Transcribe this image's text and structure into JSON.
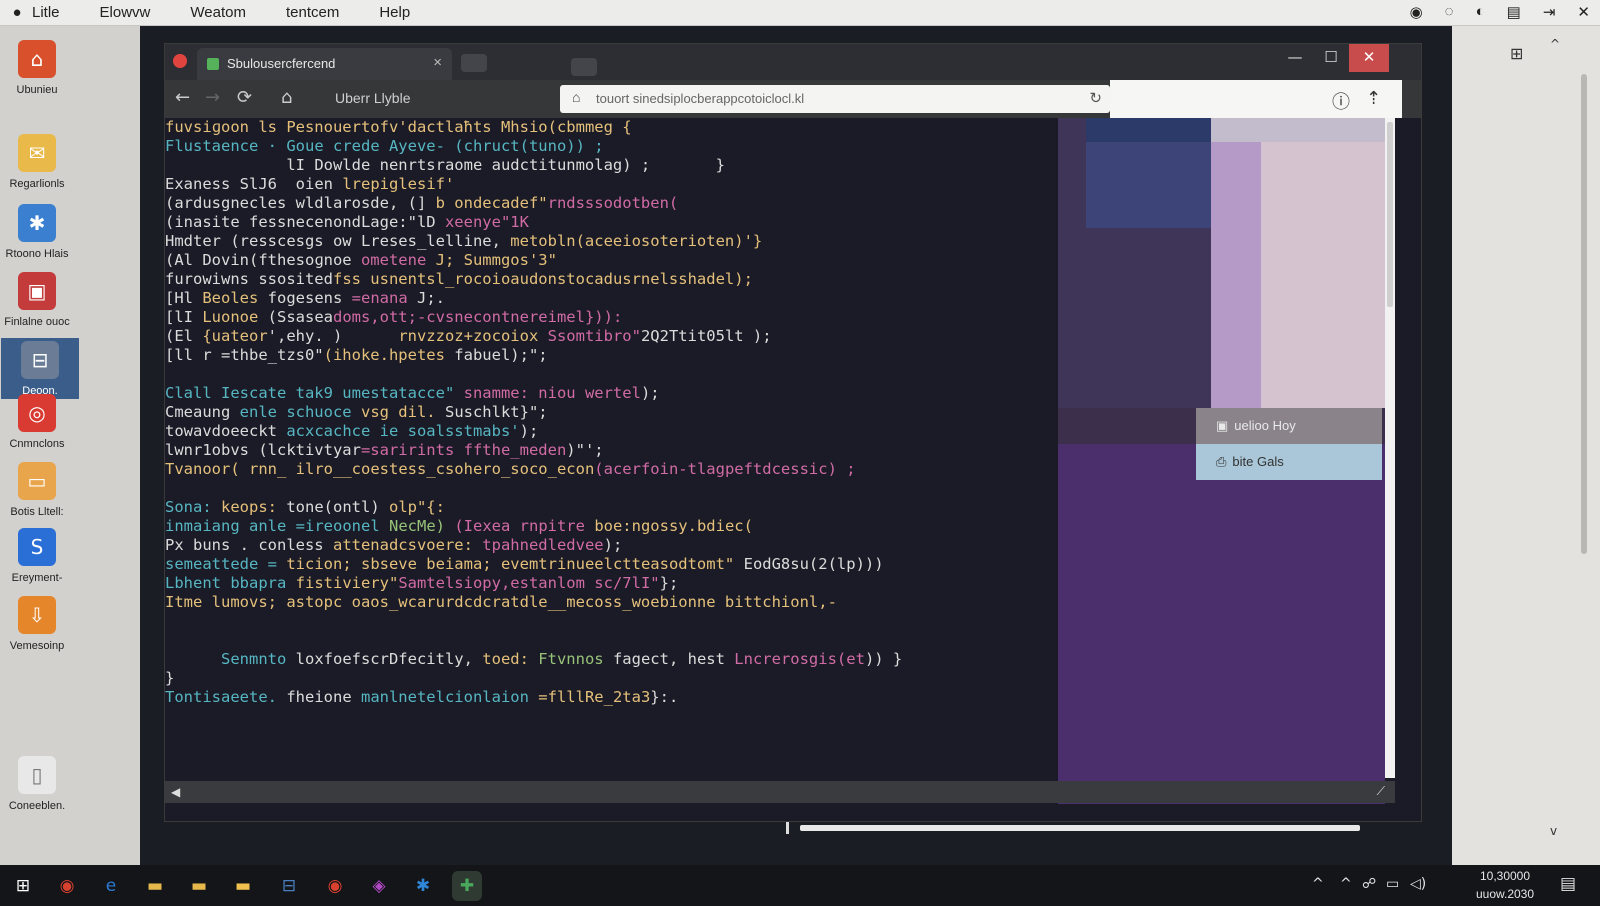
{
  "menubar": {
    "apple_icon": "apple-icon",
    "items": [
      "Litle",
      "Elowvw",
      "Weatom",
      "tentcem",
      "Help"
    ],
    "status_icons": [
      "◉",
      "◌",
      "◐",
      "▤",
      "⇥",
      "✕"
    ]
  },
  "desktop": {
    "icons": [
      {
        "label": "Ubunieu",
        "glyph": "⌂",
        "color": "#d9502c"
      },
      {
        "label": "Regarlionls",
        "glyph": "✉",
        "color": "#e9b94a"
      },
      {
        "label": "Rtoono Hlais",
        "glyph": "✱",
        "color": "#3b7fd0"
      },
      {
        "label": "Finlalne ouoc",
        "glyph": "▣",
        "color": "#c43b3b"
      },
      {
        "label": "Deoon.",
        "glyph": "⊟",
        "color": "#6b7d96"
      },
      {
        "label": "Cnmnclons",
        "glyph": "◎",
        "color": "#d93a31"
      },
      {
        "label": "Botis Lltell:",
        "glyph": "▭",
        "color": "#e8a54b"
      },
      {
        "label": "Ereyment-",
        "glyph": "S",
        "color": "#2a6fd6"
      },
      {
        "label": "Vemesoinp",
        "glyph": "⇩",
        "color": "#e6862b"
      },
      {
        "label": "Coneeblen.",
        "glyph": "▯",
        "color": "#e8e8e8"
      }
    ],
    "right_icon": "⊞",
    "right_scroll_up": "^",
    "right_scroll_down": "v"
  },
  "browser": {
    "tab_title": "Sbulousercfercend",
    "tab_close": "×",
    "win_min": "—",
    "win_max": "☐",
    "win_close": "✕",
    "back": "←",
    "forward": "→",
    "reload": "⟳",
    "home": "⌂",
    "path_label": "Uberr Llyble",
    "url": "touort sinedsiplocberappcotoiclocl.kl",
    "url_reload": "↻",
    "info_icon": "ⓘ",
    "share_icon": "⇡",
    "hscroll_left": "◀",
    "resize": "⟋"
  },
  "code_lines": [
    [
      {
        "t": "fuvsiɡoon ls Pesnouertofv'dactlaħts ",
        "c": "y"
      },
      {
        "t": "Mhsio(cbmmeg {",
        "c": "y"
      }
    ],
    [
      {
        "t": "Flustaence · ",
        "c": "c"
      },
      {
        "t": "Goue crede Ayeve- (chruct(tuno)) ;",
        "c": "c"
      }
    ],
    [
      {
        "t": "             lI ",
        "c": "w"
      },
      {
        "t": "Dowlde nenrtsraome audctitunmolag) ;       }",
        "c": "w"
      }
    ],
    [
      {
        "t": "Exaness SlJ6  ",
        "c": "w"
      },
      {
        "t": "oien ",
        "c": "w"
      },
      {
        "t": "lrepiglesif'",
        "c": "y"
      }
    ],
    [
      {
        "t": "(ardusgnecles wldlarosde, (] ",
        "c": "w"
      },
      {
        "t": "b ondecadef\"",
        "c": "y"
      },
      {
        "t": "rndsssodotben(",
        "c": "p"
      }
    ],
    [
      {
        "t": "(inasite fessnecenondLage:\"lD ",
        "c": "w"
      },
      {
        "t": "xeenye\"1K",
        "c": "p"
      }
    ],
    [
      {
        "t": "Hmdter (resscesgs ow Lreses_lelline, ",
        "c": "w"
      },
      {
        "t": "metobln(aceeiosoterioten)'}",
        "c": "y"
      }
    ],
    [
      {
        "t": "(Al Dovin(fthesoɡnoe ",
        "c": "w"
      },
      {
        "t": "ometene ",
        "c": "p"
      },
      {
        "t": "J; Summgos'3\"",
        "c": "y"
      }
    ],
    [
      {
        "t": "furowiwns ssosited",
        "c": "w"
      },
      {
        "t": "fss usnentsl_rocoioaudonstocadusrnelsshadel);",
        "c": "y"
      }
    ],
    [
      {
        "t": "[Hl ",
        "c": "w"
      },
      {
        "t": "Beoles ",
        "c": "y"
      },
      {
        "t": "fogesens ",
        "c": "w"
      },
      {
        "t": "=enana ",
        "c": "p"
      },
      {
        "t": "J;.",
        "c": "w"
      }
    ],
    [
      {
        "t": "[lI ",
        "c": "w"
      },
      {
        "t": "Luonoe ",
        "c": "y"
      },
      {
        "t": "(Ssasea",
        "c": "w"
      },
      {
        "t": "doms,ott;-cvsnecontnereimel})):",
        "c": "p"
      }
    ],
    [
      {
        "t": "(El ",
        "c": "w"
      },
      {
        "t": "{uateor",
        "c": "y"
      },
      {
        "t": "',ehy. )      ",
        "c": "w"
      },
      {
        "t": "rnvzzoz+zocoiox ",
        "c": "y"
      },
      {
        "t": "Ssomtibro\"",
        "c": "p"
      },
      {
        "t": "2Q2Ttit05lt );",
        "c": "w"
      }
    ],
    [
      {
        "t": "[ll r =thbe_tzs0\"",
        "c": "w"
      },
      {
        "t": "(ihoke.hpetes ",
        "c": "y"
      },
      {
        "t": "fabuel);\";",
        "c": "w"
      }
    ],
    [],
    [
      {
        "t": "Clall Iescate tak9 umestatacce\" ",
        "c": "c"
      },
      {
        "t": "snamme: niou wertel",
        "c": "p"
      },
      {
        "t": ");",
        "c": "w"
      }
    ],
    [
      {
        "t": "Cmeaung ",
        "c": "w"
      },
      {
        "t": "enle schuoce ",
        "c": "c"
      },
      {
        "t": "vsg dil. ",
        "c": "y"
      },
      {
        "t": "Suschlkt",
        "c": "w"
      },
      {
        "t": "}\";",
        "c": "w"
      }
    ],
    [
      {
        "t": "towavdoeeckt ",
        "c": "w"
      },
      {
        "t": "acxcachce ie soalsstmabs'",
        "c": "c"
      },
      {
        "t": ");",
        "c": "w"
      }
    ],
    [
      {
        "t": "lwnr1obvs (lcktivtyar",
        "c": "w"
      },
      {
        "t": "=sarirints ",
        "c": "p"
      },
      {
        "t": "ffthe_meden",
        "c": "p"
      },
      {
        "t": ")\"';",
        "c": "w"
      }
    ],
    [
      {
        "t": "Tvanoor( ",
        "c": "y"
      },
      {
        "t": "rnn_ ",
        "c": "y"
      },
      {
        "t": "ilro__coestess_csohero_soco_econ",
        "c": "y"
      },
      {
        "t": "(acerfoin-tlagpeftdcessic) ;",
        "c": "p"
      }
    ],
    [],
    [
      {
        "t": "Sona: ",
        "c": "c"
      },
      {
        "t": "keops: ",
        "c": "y"
      },
      {
        "t": "tone(ontl) ",
        "c": "w"
      },
      {
        "t": "olp\"{:",
        "c": "y"
      }
    ],
    [
      {
        "t": "inmaiang ",
        "c": "c"
      },
      {
        "t": "anle ",
        "c": "c"
      },
      {
        "t": "=ireoonel ",
        "c": "c"
      },
      {
        "t": "NecMe) ",
        "c": "g"
      },
      {
        "t": "(Iexea rnpitre ",
        "c": "p"
      },
      {
        "t": "boe:ngossy.bdiec(",
        "c": "y"
      }
    ],
    [
      {
        "t": "Px buns . conless ",
        "c": "w"
      },
      {
        "t": "attenadcsvoere: ",
        "c": "y"
      },
      {
        "t": "tpahnedledvee",
        "c": "p"
      },
      {
        "t": ");",
        "c": "w"
      }
    ],
    [
      {
        "t": "semeattede = ",
        "c": "c"
      },
      {
        "t": "ticion; ",
        "c": "y"
      },
      {
        "t": "sbseve beiama; ",
        "c": "y"
      },
      {
        "t": "evemtrinueelctteasodtomt\" ",
        "c": "y"
      },
      {
        "t": "EodG8su(2(lp)))",
        "c": "w"
      }
    ],
    [
      {
        "t": "Lbhent bbapra ",
        "c": "c"
      },
      {
        "t": "fistiviery\"",
        "c": "y"
      },
      {
        "t": "Samtelsiopy,estanlom sc/7lI\"",
        "c": "p"
      },
      {
        "t": "};",
        "c": "w"
      }
    ],
    [
      {
        "t": "Itme lumovs; astopc oaos_wcarurdcdcratdle__mecoss_woebionne ",
        "c": "y"
      },
      {
        "t": "bittchionl,-",
        "c": "y"
      }
    ],
    [],
    [],
    [
      {
        "t": "      Senmnto ",
        "c": "c"
      },
      {
        "t": "loxfoefscrDfecitly, ",
        "c": "w"
      },
      {
        "t": "toed: ",
        "c": "y"
      },
      {
        "t": "Ftvnnos ",
        "c": "g"
      },
      {
        "t": "fagect, hest ",
        "c": "w"
      },
      {
        "t": "Lncrerosgis(et",
        "c": "p"
      },
      {
        "t": ")) }",
        "c": "w"
      }
    ],
    [
      {
        "t": "}",
        "c": "w"
      }
    ],
    [
      {
        "t": "Tontisaeete. ",
        "c": "c"
      },
      {
        "t": "fheione ",
        "c": "w"
      },
      {
        "t": "manlnetelcionlaion ",
        "c": "c"
      },
      {
        "t": "=flllRe_2ta3",
        "c": "y"
      },
      {
        "t": "}:.",
        "c": "w"
      }
    ]
  ],
  "context_menu": {
    "item1": "uelioo Hoy",
    "item1_icon": "▣",
    "item2": "bite Gals",
    "item2_icon": "⎙"
  },
  "taskbar": {
    "start_icon": "windows-start-icon",
    "apps": [
      {
        "name": "chrome-icon",
        "glyph": "◉",
        "color": "#d9412f"
      },
      {
        "name": "edge-icon",
        "glyph": "e",
        "color": "#2b7bd6"
      },
      {
        "name": "folder-icon",
        "glyph": "▬",
        "color": "#e6b84c"
      },
      {
        "name": "folder-icon-2",
        "glyph": "▬",
        "color": "#e6b84c"
      },
      {
        "name": "folder-icon-3",
        "glyph": "▬",
        "color": "#f0c14f"
      },
      {
        "name": "explorer-icon",
        "glyph": "⊟",
        "color": "#4a7fc2"
      },
      {
        "name": "chrome-icon-2",
        "glyph": "◉",
        "color": "#d9412f"
      },
      {
        "name": "paint-icon",
        "glyph": "◈",
        "color": "#b249c4"
      },
      {
        "name": "store-icon",
        "glyph": "✱",
        "color": "#2f86d8"
      },
      {
        "name": "puzzle-icon",
        "glyph": "✚",
        "color": "#49a85c"
      }
    ],
    "tray": [
      "^",
      "^",
      "☍",
      "▭",
      "◁)"
    ],
    "clock_time": "10,30000",
    "clock_date": "uuow.2030",
    "notification_icon": "▤"
  }
}
